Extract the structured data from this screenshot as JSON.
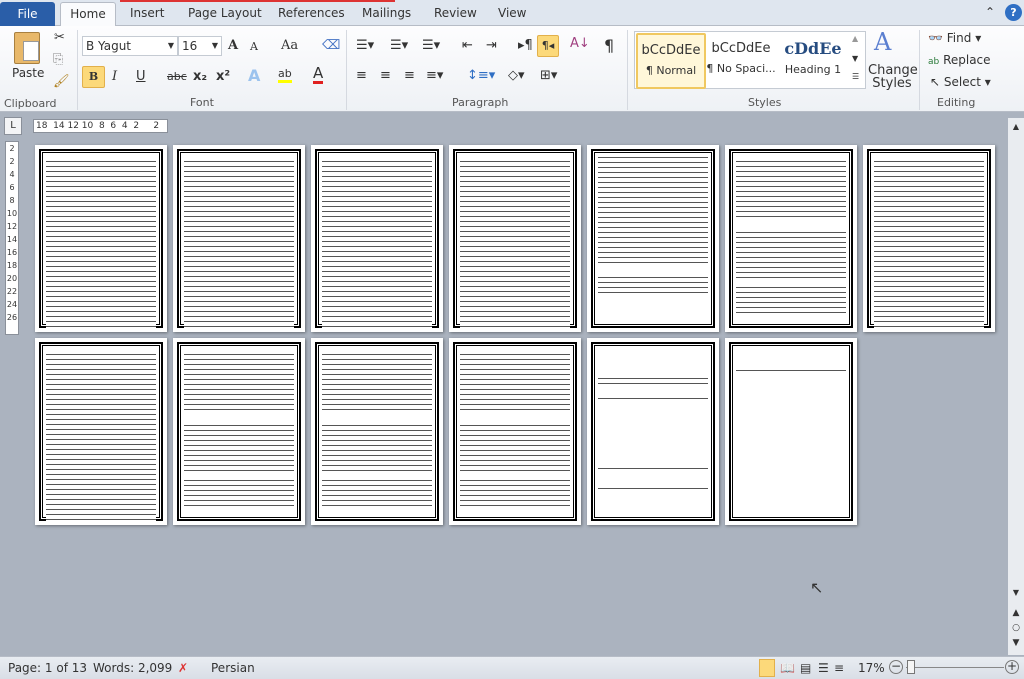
{
  "tabs": {
    "file": "File",
    "items": [
      "Home",
      "Insert",
      "Page Layout",
      "References",
      "Mailings",
      "Review",
      "View"
    ]
  },
  "clipboard": {
    "paste": "Paste",
    "label": "Clipboard"
  },
  "font": {
    "name": "B Yagut",
    "size": "16",
    "label": "Font",
    "grow": "A",
    "shrink": "A",
    "case": "Aa",
    "bold": "B",
    "italic": "I",
    "underline": "U",
    "strike": "abc",
    "sub": "x₂",
    "sup": "x²",
    "effects": "A",
    "highlight": "ab",
    "color": "A",
    "colors": {
      "highlight": "#ffff00",
      "font": "#e02020"
    }
  },
  "paragraph": {
    "label": "Paragraph",
    "pilcrow": "¶"
  },
  "styles": {
    "label": "Styles",
    "items": [
      {
        "sample": "bCcDdEe",
        "name": "¶ Normal"
      },
      {
        "sample": "bCcDdEe",
        "name": "¶ No Spaci..."
      },
      {
        "sample": "cDdEe",
        "name": "Heading 1"
      }
    ],
    "change": "Change Styles"
  },
  "editing": {
    "label": "Editing",
    "find": "Find",
    "replace": "Replace",
    "select": "Select"
  },
  "ruler": {
    "horizontal": "18  14 12 10  8  6  4  2     2",
    "vertical": [
      "2",
      "2",
      "4",
      "6",
      "8",
      "10",
      "12",
      "14",
      "16",
      "18",
      "20",
      "22",
      "24",
      "26"
    ]
  },
  "pages": [
    {
      "fill": "full"
    },
    {
      "fill": "full"
    },
    {
      "fill": "full"
    },
    {
      "fill": "full"
    },
    {
      "fill": "list"
    },
    {
      "fill": "partial"
    },
    {
      "fill": "full"
    },
    {
      "fill": "full"
    },
    {
      "fill": "partial"
    },
    {
      "fill": "partial"
    },
    {
      "fill": "partial"
    },
    {
      "fill": "sparse"
    },
    {
      "fill": "line"
    }
  ],
  "status": {
    "page": "Page: 1 of 13",
    "words": "Words: 2,099",
    "language": "Persian",
    "zoom": "17%",
    "zoom_percent": 17
  }
}
